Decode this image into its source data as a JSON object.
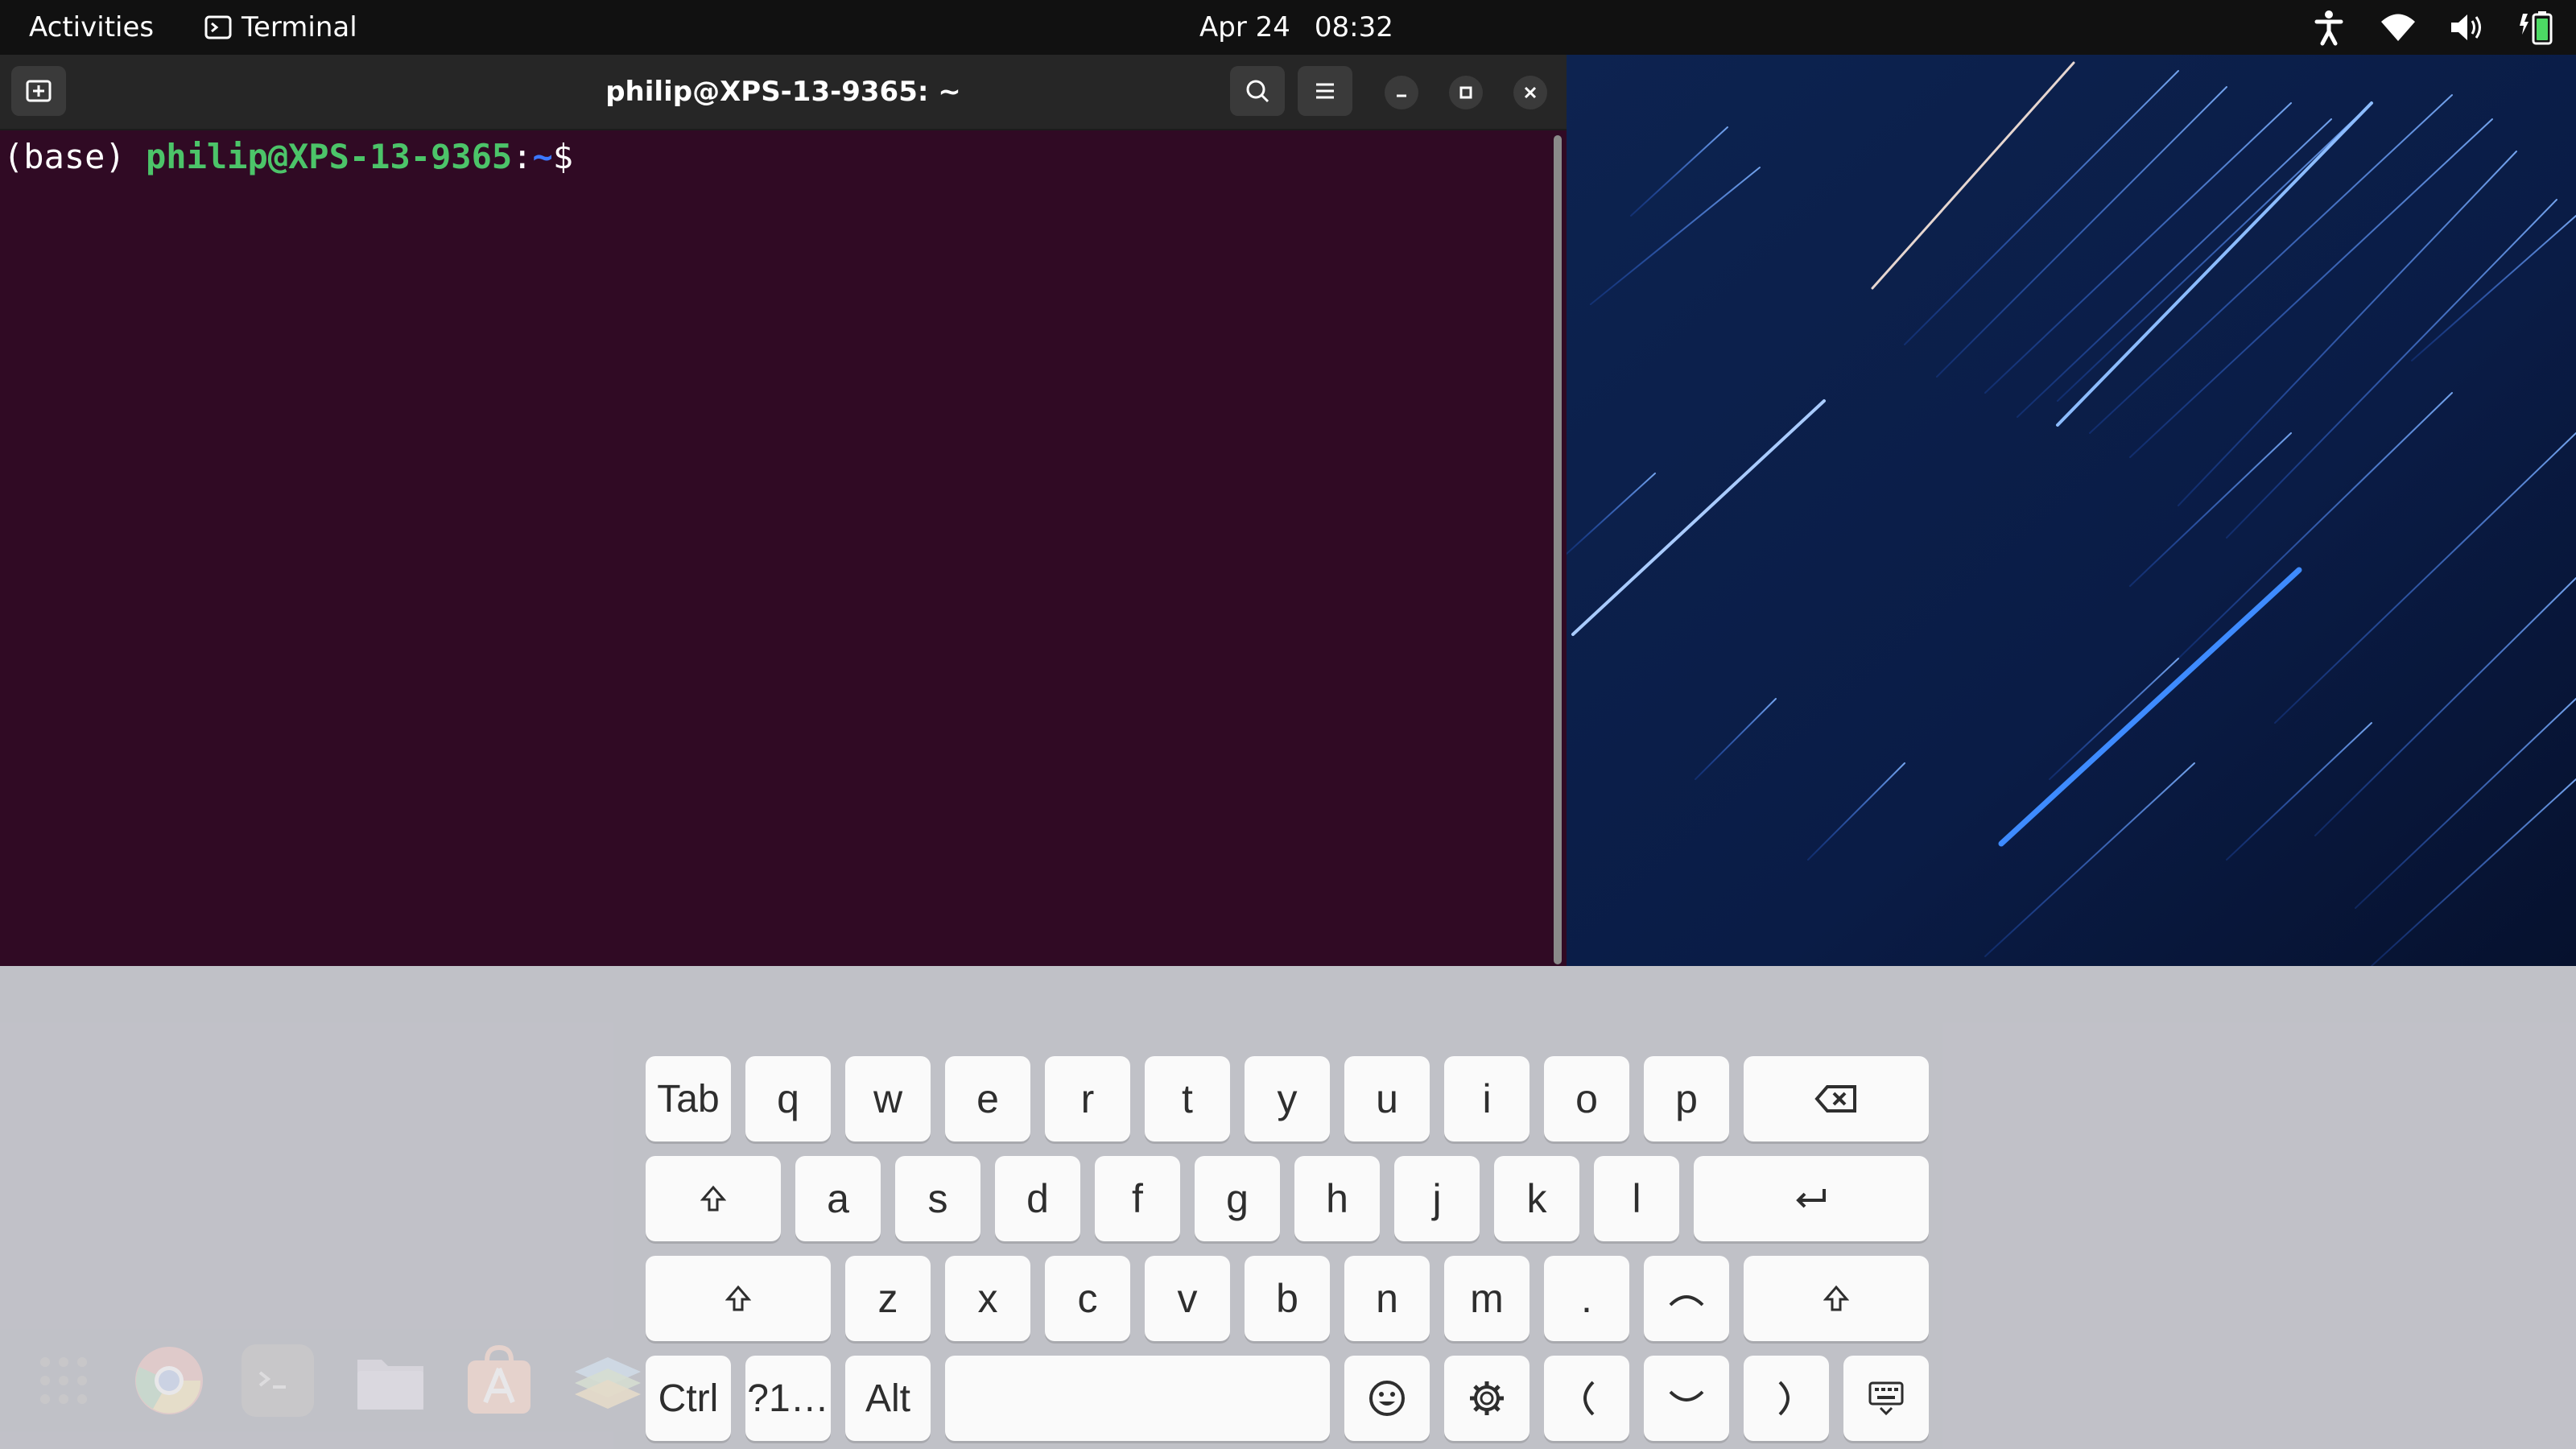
{
  "topbar": {
    "activities": "Activities",
    "app_name": "Terminal",
    "date": "Apr 24",
    "time": "08:32",
    "tray_icons": [
      "accessibility-icon",
      "wifi-icon",
      "volume-icon",
      "battery-icon"
    ]
  },
  "terminal": {
    "title": "philip@XPS-13-9365: ~",
    "header_buttons": [
      "new-tab-icon",
      "search-icon",
      "menu-icon",
      "minimize-icon",
      "maximize-icon",
      "close-icon"
    ],
    "prompt_env": "(base) ",
    "prompt_user": "philip@XPS-13-9365",
    "prompt_sep": ":",
    "prompt_path": "~",
    "prompt_symbol": "$",
    "colors": {
      "background": "#300a24",
      "user": "#4cc469",
      "path": "#3b78ff",
      "header": "#262626"
    }
  },
  "dock": {
    "items": [
      "show-apps-icon",
      "chrome-icon",
      "terminal-icon",
      "files-icon",
      "app-center-icon",
      "layers-icon"
    ]
  },
  "keyboard": {
    "row1": [
      "Tab",
      "q",
      "w",
      "e",
      "r",
      "t",
      "y",
      "u",
      "i",
      "o",
      "p"
    ],
    "row1_backspace_icon": "backspace-icon",
    "row2_shift_icon": "shift-icon",
    "row2": [
      "a",
      "s",
      "d",
      "f",
      "g",
      "h",
      "j",
      "k",
      "l"
    ],
    "row2_enter_icon": "enter-icon",
    "row3_shift_icon": "shift-icon",
    "row3": [
      "z",
      "x",
      "c",
      "v",
      "b",
      "n",
      "m",
      "."
    ],
    "row3_up_icon": "arrow-up-icon",
    "row3_right_shift_icon": "shift-icon",
    "row4_ctrl": "Ctrl",
    "row4_symbols": "?1…",
    "row4_alt": "Alt",
    "row4_icons": [
      "emoji-icon",
      "settings-icon",
      "arrow-left-icon",
      "arrow-down-icon",
      "arrow-right-icon",
      "hide-keyboard-icon"
    ]
  }
}
